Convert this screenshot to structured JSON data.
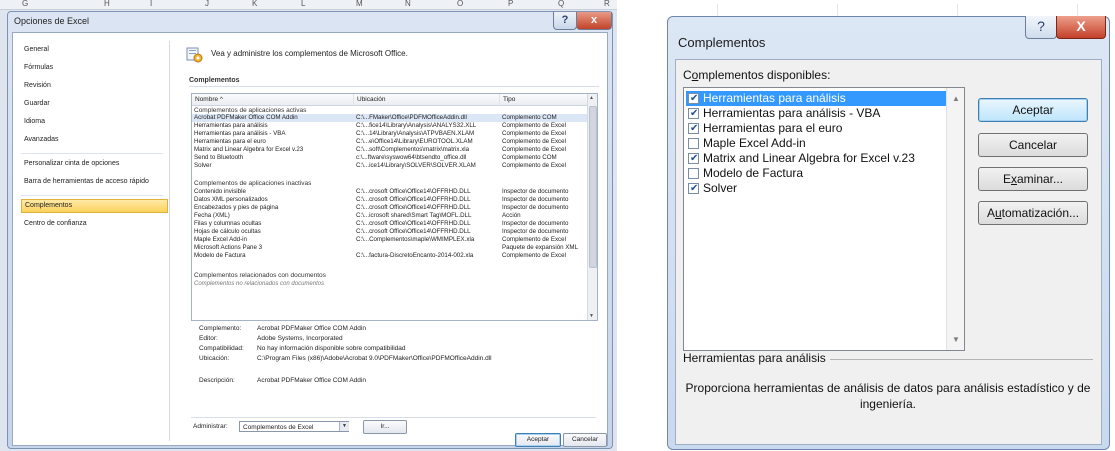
{
  "excel_options": {
    "column_headers": [
      "G",
      "H",
      "I",
      "J",
      "K",
      "L",
      "M",
      "N",
      "O",
      "P",
      "Q",
      "R"
    ],
    "title": "Opciones de Excel",
    "help_glyph": "?",
    "close_glyph": "x",
    "nav_items": [
      {
        "label": "General",
        "selected": false
      },
      {
        "label": "Fórmulas",
        "selected": false
      },
      {
        "label": "Revisión",
        "selected": false
      },
      {
        "label": "Guardar",
        "selected": false
      },
      {
        "label": "Idioma",
        "selected": false
      },
      {
        "label": "Avanzadas",
        "selected": false
      },
      {
        "label": "Personalizar cinta de opciones",
        "selected": false
      },
      {
        "label": "Barra de herramientas de acceso rápido",
        "selected": false
      },
      {
        "label": "Complementos",
        "selected": true
      },
      {
        "label": "Centro de confianza",
        "selected": false
      }
    ],
    "header_text": "Vea y administre los complementos de Microsoft Office.",
    "section_title": "Complementos",
    "list_columns": {
      "name": "Nombre ^",
      "location": "Ubicación",
      "type": "Tipo"
    },
    "groups": {
      "active": "Complementos de aplicaciones activas",
      "inactive": "Complementos de aplicaciones inactivas",
      "document": "Complementos relacionados con documentos",
      "document_sub": "Complementos no relacionados con documentos"
    },
    "active_rows": [
      {
        "name": "Acrobat PDFMaker Office COM Addin",
        "location": "C:\\...FMaker\\Office\\PDFMOfficeAddin.dll",
        "type": "Complemento COM"
      },
      {
        "name": "Herramientas para análisis",
        "location": "C:\\...fice14\\Library\\Analysis\\ANALYS32.XLL",
        "type": "Complemento de Excel"
      },
      {
        "name": "Herramientas para análisis - VBA",
        "location": "C:\\...14\\Library\\Analysis\\ATPVBAEN.XLAM",
        "type": "Complemento de Excel"
      },
      {
        "name": "Herramientas para el euro",
        "location": "C:\\...e\\Office14\\Library\\EUROTOOL.XLAM",
        "type": "Complemento de Excel"
      },
      {
        "name": "Matrix and Linear Algebra for Excel v.23",
        "location": "C:\\...soft\\Complementos\\matrix\\matrix.xla",
        "type": "Complemento de Excel"
      },
      {
        "name": "Send to Bluetooth",
        "location": "c:\\...ftware\\syswow64\\btsendto_office.dll",
        "type": "Complemento COM"
      },
      {
        "name": "Solver",
        "location": "C:\\...ice14\\Library\\SOLVER\\SOLVER.XLAM",
        "type": "Complemento de Excel"
      }
    ],
    "inactive_rows": [
      {
        "name": "Contenido invisible",
        "location": "C:\\...crosoft Office\\Office14\\OFFRHD.DLL",
        "type": "Inspector de documento"
      },
      {
        "name": "Datos XML personalizados",
        "location": "C:\\...crosoft Office\\Office14\\OFFRHD.DLL",
        "type": "Inspector de documento"
      },
      {
        "name": "Encabezados y pies de página",
        "location": "C:\\...crosoft Office\\Office14\\OFFRHD.DLL",
        "type": "Inspector de documento"
      },
      {
        "name": "Fecha (XML)",
        "location": "C:\\...icrosoft shared\\Smart Tag\\MOFL.DLL",
        "type": "Acción"
      },
      {
        "name": "Filas y columnas ocultas",
        "location": "C:\\...crosoft Office\\Office14\\OFFRHD.DLL",
        "type": "Inspector de documento"
      },
      {
        "name": "Hojas de cálculo ocultas",
        "location": "C:\\...crosoft Office\\Office14\\OFFRHD.DLL",
        "type": "Inspector de documento"
      },
      {
        "name": "Maple Excel Add-in",
        "location": "C:\\...Complementos\\maple\\WMIMPLEX.xla",
        "type": "Complemento de Excel"
      },
      {
        "name": "Microsoft Actions Pane 3",
        "location": "",
        "type": "Paquete de expansión XML"
      },
      {
        "name": "Modelo de Factura",
        "location": "C:\\...factura-DiscretoEncanto-2014-002.xla",
        "type": "Complemento de Excel"
      }
    ],
    "details": {
      "addin_key": "Complemento:",
      "addin_val": "Acrobat PDFMaker Office COM Addin",
      "editor_key": "Editor:",
      "editor_val": "Adobe Systems, Incorporated",
      "compat_key": "Compatibilidad:",
      "compat_val": "No hay información disponible sobre compatibilidad",
      "location_key": "Ubicación:",
      "location_val": "C:\\Program Files (x86)\\Adobe\\Acrobat 9.0\\PDFMaker\\Office\\PDFMOfficeAddin.dll",
      "desc_key": "Descripción:",
      "desc_val": "Acrobat PDFMaker Office COM Addin"
    },
    "manage_label": "Administrar:",
    "manage_value": "Complementos de Excel",
    "go_label": "Ir...",
    "ok_label": "Aceptar",
    "cancel_label": "Cancelar"
  },
  "complementos": {
    "title": "Complementos",
    "help_glyph": "?",
    "close_glyph": "X",
    "available_prefix": "C",
    "available_underlined": "o",
    "available_rest": "mplementos disponibles:",
    "items": [
      {
        "label": "Herramientas para análisis",
        "checked": true,
        "selected": true
      },
      {
        "label": "Herramientas para análisis - VBA",
        "checked": true,
        "selected": false
      },
      {
        "label": "Herramientas para el euro",
        "checked": true,
        "selected": false
      },
      {
        "label": "Maple Excel Add-in",
        "checked": false,
        "selected": false
      },
      {
        "label": "Matrix and Linear Algebra for Excel  v.23",
        "checked": true,
        "selected": false
      },
      {
        "label": "Modelo de Factura",
        "checked": false,
        "selected": false
      },
      {
        "label": "Solver",
        "checked": true,
        "selected": false
      }
    ],
    "ok_label": "Aceptar",
    "cancel_label": "Cancelar",
    "browse_prefix": "E",
    "browse_underlined": "x",
    "browse_rest": "aminar...",
    "auto_prefix": "A",
    "auto_underlined": "u",
    "auto_rest": "tomatización...",
    "description_title": "Herramientas para análisis",
    "description_text": "Proporciona herramientas de análisis de datos para análisis estadístico y de ingeniería."
  }
}
